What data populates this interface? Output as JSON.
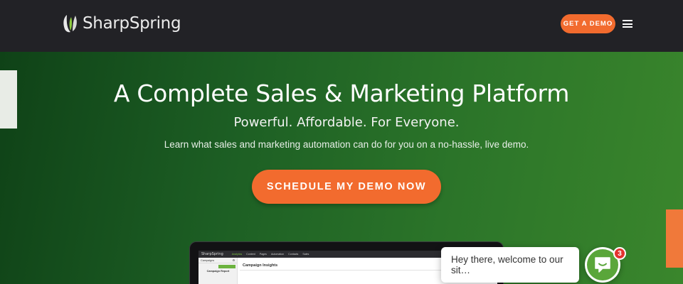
{
  "header": {
    "logo_text": "SharpSpring",
    "demo_button": "GET A DEMO",
    "menu_icon": "hamburger-menu-icon"
  },
  "hero": {
    "title": "A Complete Sales & Marketing Platform",
    "subtitle": "Powerful. Affordable. For Everyone.",
    "description": "Learn what sales and marketing automation can do for you on a no-hassle, live demo.",
    "cta_button": "SCHEDULE MY DEMO NOW"
  },
  "app_preview": {
    "logo": "SharpSpring",
    "nav_items": [
      "Analytics",
      "Content",
      "Pages",
      "Automation",
      "Contacts",
      "Sales"
    ],
    "sidebar_title": "Campaigns",
    "sidebar_item": "Campaign Report",
    "main_title": "Campaign Insights"
  },
  "chat": {
    "message": "Hey there, welcome to our sit…",
    "badge_count": "3",
    "icon": "chat-smile-icon"
  },
  "colors": {
    "accent_orange": "#f26b2e",
    "header_dark": "#222226",
    "hero_green_dark": "#0f4217",
    "hero_green_light": "#3a862c",
    "chat_green": "#5aa63a",
    "badge_red": "#e3322e"
  }
}
